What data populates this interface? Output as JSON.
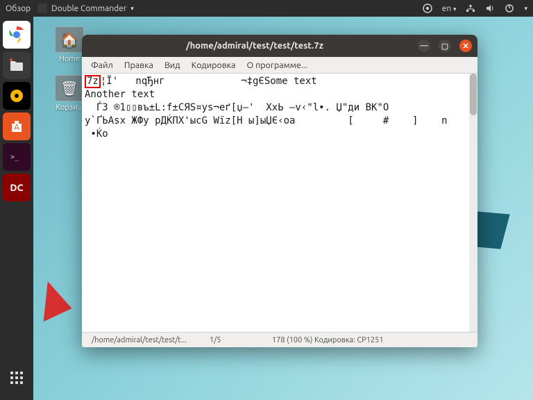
{
  "topbar": {
    "activities": "Обзор",
    "app_name": "Double Commander",
    "language": "en"
  },
  "desktop": {
    "home": "Home",
    "trash": "Корзи..."
  },
  "window": {
    "title": "/home/admiral/test/test/test.7z",
    "menu": {
      "file": "Файл",
      "edit": "Правка",
      "view": "Вид",
      "encoding": "Кодировка",
      "about": "О программе..."
    },
    "content": {
      "highlight": "7z",
      "line1_rest": "¦Ï'   nqЂнг             ¬‡gЄSome text",
      "line2": "Another text",
      "line3": "  ЃЗ ®1▯▯въ±L:f±CЯS¤ys¬еґ[џ—'  ХxЬ —v‹\"l•. Џ\"ди ВК\"О",
      "line4": "у`ҐЬАѕх ЖФу рДЌПХ'ыcG Wїz[Н ы]ыЏЄ‹оа         [     #    ]    n",
      "line5": " •Ќo"
    },
    "status": {
      "path": "/home/admiral/test/test/t...",
      "position": "1/5",
      "percent": "178 (100 %) Кодировка: CP1251"
    }
  }
}
